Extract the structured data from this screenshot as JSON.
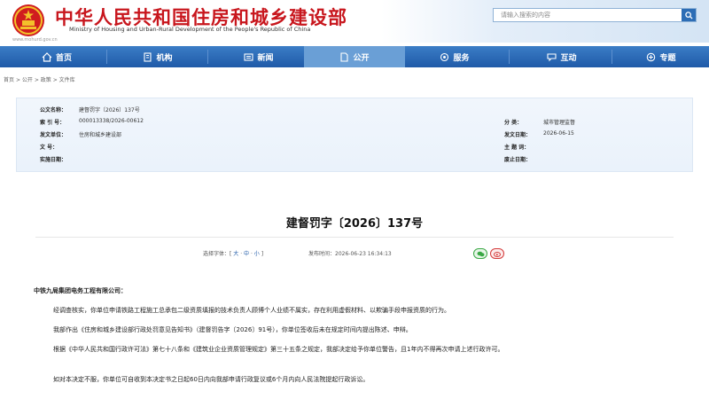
{
  "header": {
    "title": "中华人民共和国住房和城乡建设部",
    "subtitle": "Ministry of Housing and Urban-Rural Development of the People's Republic of China",
    "url": "www.mohurd.gov.cn",
    "emblem_icon": "national-emblem-icon"
  },
  "search": {
    "placeholder": "请输入搜索的内容",
    "value": "",
    "button_icon": "search-icon"
  },
  "nav": {
    "items": [
      {
        "label": "首页",
        "icon": "home-icon"
      },
      {
        "label": "机构",
        "icon": "building-icon"
      },
      {
        "label": "新闻",
        "icon": "news-icon"
      },
      {
        "label": "公开",
        "icon": "document-icon",
        "active": true
      },
      {
        "label": "服务",
        "icon": "service-icon"
      },
      {
        "label": "互动",
        "icon": "chat-icon"
      },
      {
        "label": "专题",
        "icon": "topic-icon"
      }
    ]
  },
  "breadcrumb": {
    "items": [
      "首页",
      "公开",
      "政策",
      "文件库"
    ],
    "separator": ">"
  },
  "meta": {
    "doc_name_label": "公文名称：",
    "doc_name_value": "建督罚字〔2026〕137号",
    "index_label": "索  引  号：",
    "index_value": "000013338/2026-00612",
    "category_label": "分    类：",
    "category_value": "城市管理监督",
    "issuer_label": "发文单位：",
    "issuer_value": "住房和城乡建设部",
    "issue_date_label": "发文日期：",
    "issue_date_value": "2026-06-15",
    "doc_no_label": "文    号：",
    "subject_label": "主 题 词：",
    "effective_date_label": "实施日期：",
    "abolish_date_label": "废止日期："
  },
  "document": {
    "title": "建督罚字〔2026〕137号",
    "font_select_label": "选择字体：",
    "font_options": [
      "大",
      "中",
      "小"
    ],
    "publish_time_label": "发布时间：",
    "publish_time_value": "2026-06-23 16:34:13",
    "addressee": "中铁九局集团电务工程有限公司：",
    "paragraphs": [
      "经调查核实，你单位申请铁路工程施工总承包二级资质填报的技术负责人顾博个人业绩不属实，存在利用虚假材料、以欺骗手段申报资质的行为。",
      "我部作出《住房和城乡建设部行政处罚意见告知书》（建督罚告字〔2026〕91号），你单位签收后未在规定时间内提出陈述、申辩。",
      "根据《中华人民共和国行政许可法》第七十八条和《建筑业企业资质管理规定》第三十五条之规定，我部决定给予你单位警告，且1年内不得再次申请上述行政许可。",
      "如对本决定不服，你单位可自收到本决定书之日起60日内向我部申请行政复议或6个月内向人民法院提起行政诉讼。"
    ],
    "share_icons": [
      "wechat-icon",
      "weibo-icon"
    ]
  },
  "colors": {
    "title_red": "#c8161d",
    "nav_blue": "#1f5aa8",
    "nav_active": "#6a9fd6",
    "meta_bg": "#eaf2fb"
  }
}
